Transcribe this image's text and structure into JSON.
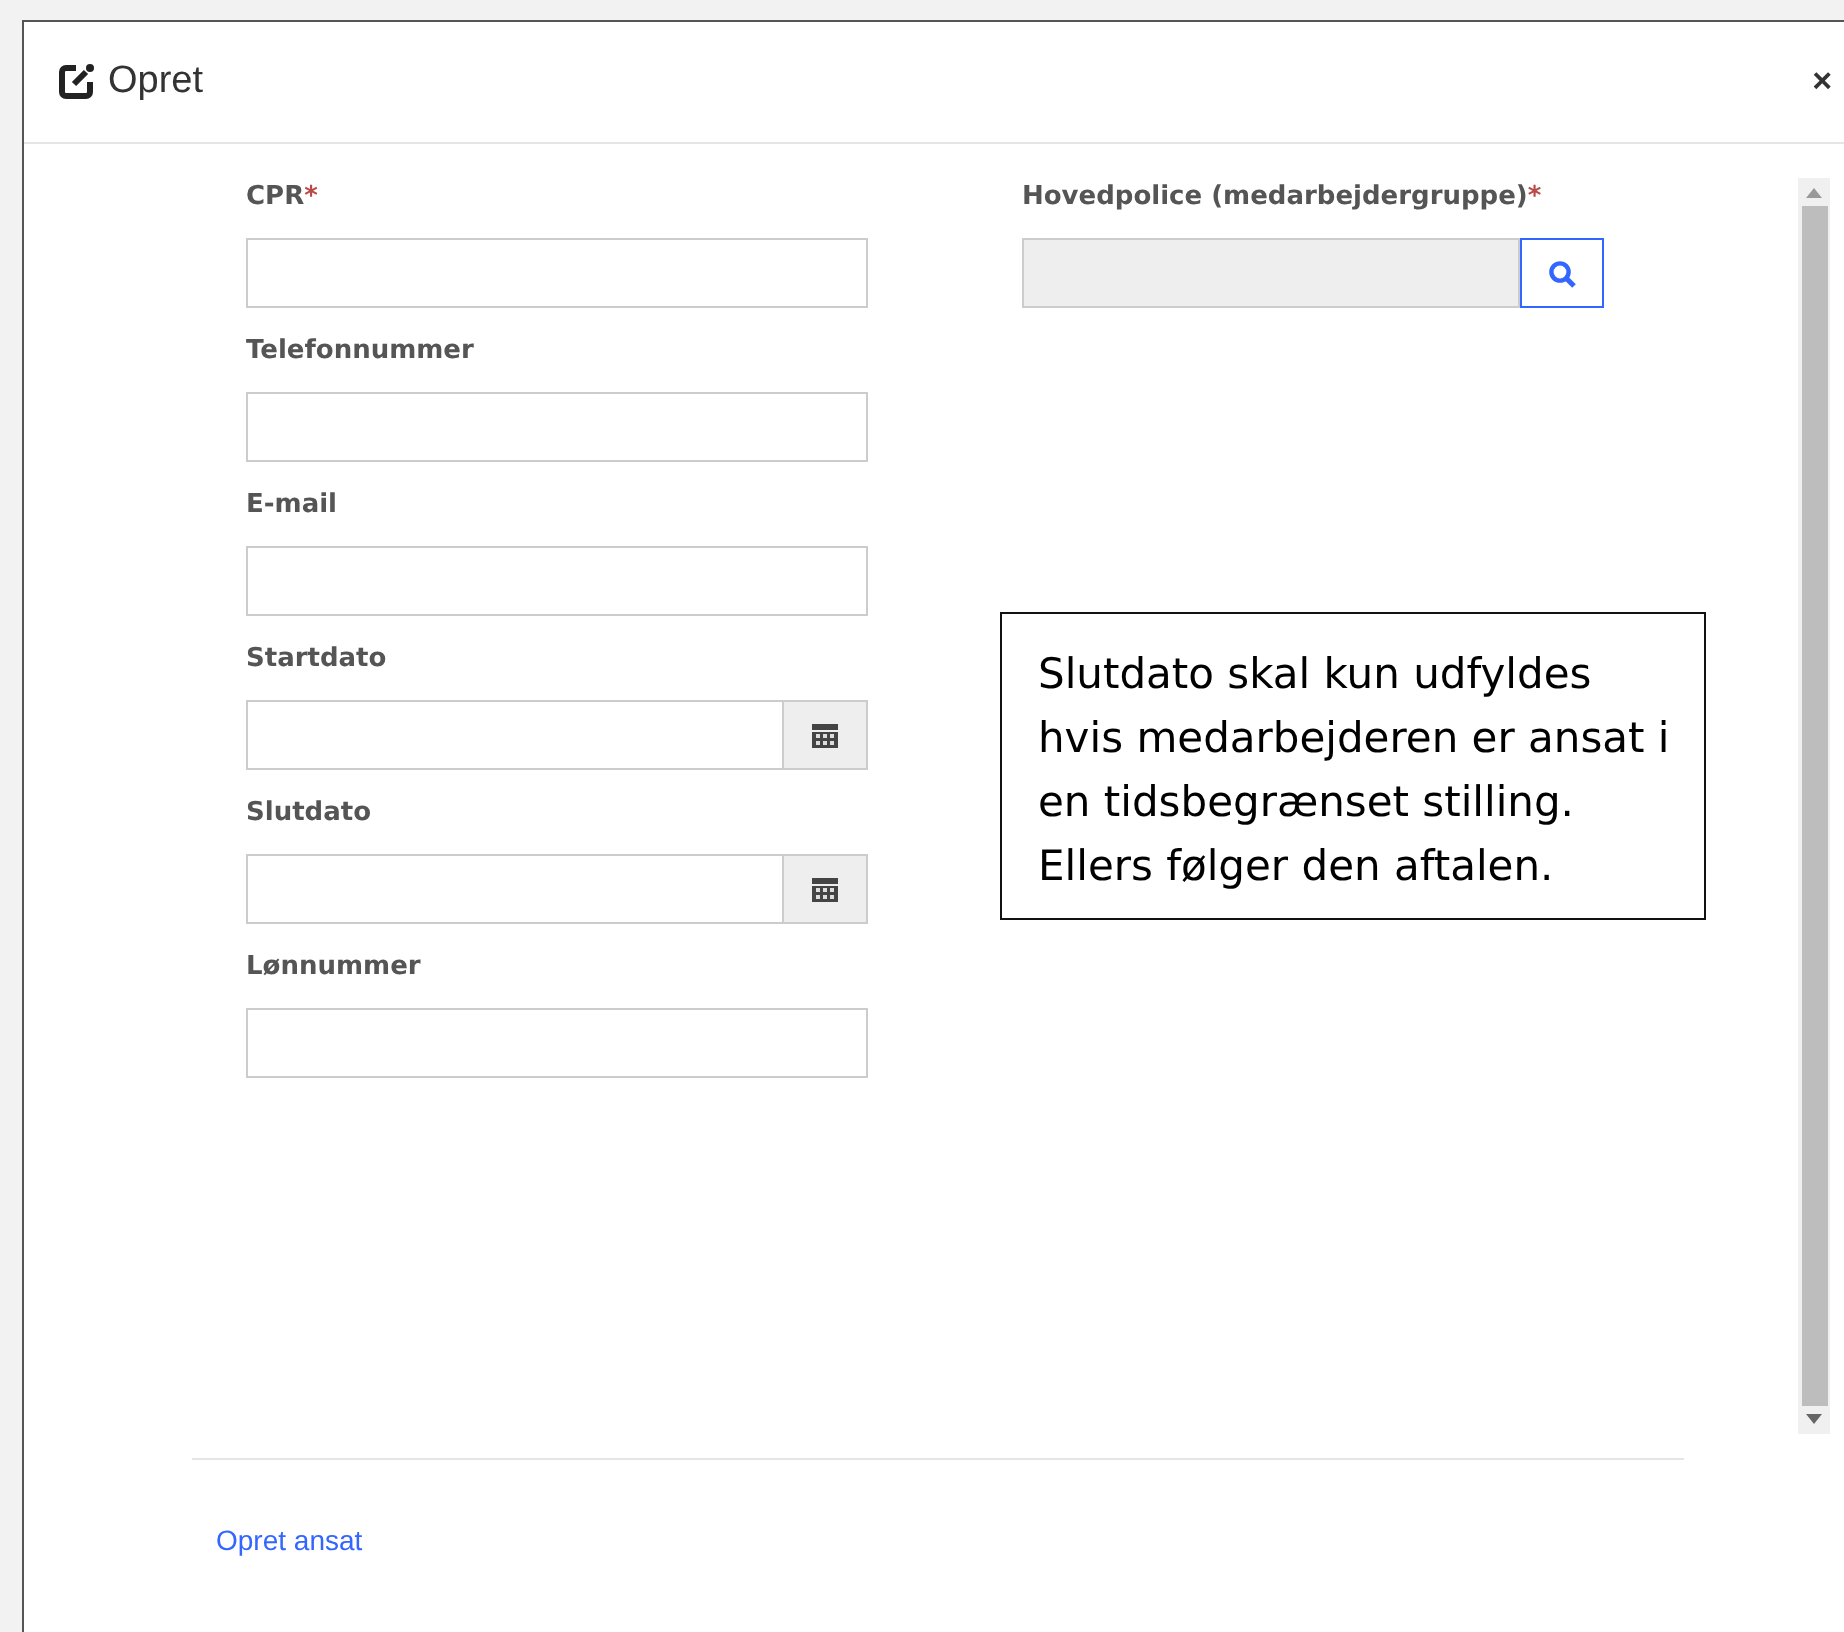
{
  "dialog": {
    "title": "Opret",
    "close": "×"
  },
  "fields": [
    {
      "label": "CPR",
      "required_mark": "*",
      "kind": "text"
    },
    {
      "label": "Telefonnummer",
      "kind": "text"
    },
    {
      "label": "E-mail",
      "kind": "text"
    },
    {
      "label": "Startdato",
      "kind": "date"
    },
    {
      "label": "Slutdato",
      "kind": "date"
    },
    {
      "label": "Lønnummer",
      "kind": "text"
    }
  ],
  "lookup": {
    "label": "Hovedpolice (medarbejdergruppe)",
    "required_mark": "*",
    "disabled": true
  },
  "note": "Slutdato skal kun udfyldes hvis medarbejderen er ansat i en tidsbegrænset stilling. Ellers følger den aftalen.",
  "footer": {
    "link": "Opret ansat"
  }
}
